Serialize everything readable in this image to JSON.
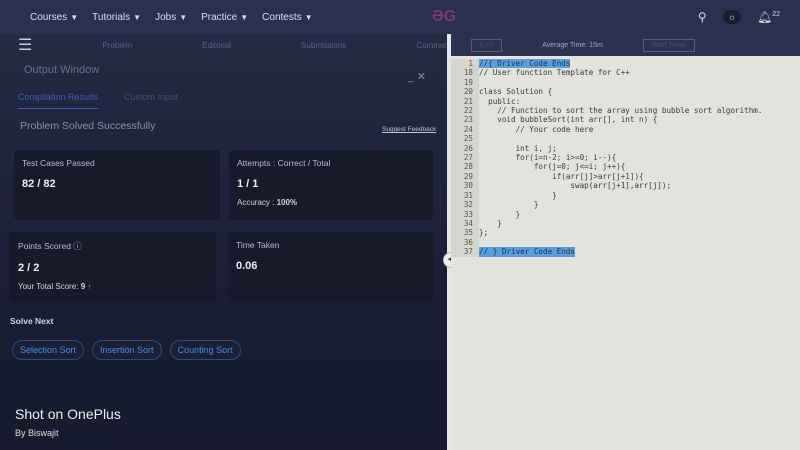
{
  "nav": {
    "items": [
      "Courses",
      "Tutorials",
      "Jobs",
      "Practice",
      "Contests"
    ],
    "notif_count": "22"
  },
  "subnav": {
    "tabs": [
      "Problem",
      "Editorial",
      "Submissions",
      "Comments"
    ],
    "avg_time": "Average Time: 15m",
    "start_timer": "Start Timer"
  },
  "output": {
    "title": "Output Window",
    "tabs": [
      "Compilation Results",
      "Custom Input"
    ],
    "status": "Problem Solved Successfully",
    "feedback": "Suggest Feedback"
  },
  "cards": {
    "tests_label": "Test Cases Passed",
    "tests_value": "82 / 82",
    "attempts_label": "Attempts : Correct / Total",
    "attempts_value": "1 / 1",
    "accuracy_label": "Accuracy :",
    "accuracy_value": "100%",
    "points_label": "Points Scored",
    "points_value": "2 / 2",
    "total_label": "Your Total Score:",
    "total_value": "9",
    "time_label": "Time Taken",
    "time_value": "0.06"
  },
  "solve_next": {
    "label": "Solve Next",
    "items": [
      "Selection Sort",
      "Insertion Sort",
      "Counting Sort"
    ]
  },
  "watermark": {
    "line1": "Shot on OnePlus",
    "line2": "By Biswajit"
  },
  "code": [
    {
      "n": "1",
      "t": "//{ Driver Code Ends",
      "hl": true
    },
    {
      "n": "18",
      "t": "// User function Template for C++"
    },
    {
      "n": "19",
      "t": ""
    },
    {
      "n": "20",
      "t": "class Solution {"
    },
    {
      "n": "21",
      "t": "  public:"
    },
    {
      "n": "22",
      "t": "    // Function to sort the array using bubble sort algorithm."
    },
    {
      "n": "23",
      "t": "    void bubbleSort(int arr[], int n) {"
    },
    {
      "n": "24",
      "t": "        // Your code here"
    },
    {
      "n": "25",
      "t": ""
    },
    {
      "n": "26",
      "t": "        int i, j;"
    },
    {
      "n": "27",
      "t": "        for(i=n-2; i>=0; i--){"
    },
    {
      "n": "28",
      "t": "            for(j=0; j<=i; j++){"
    },
    {
      "n": "29",
      "t": "                if(arr[j]>arr[j+1]){"
    },
    {
      "n": "30",
      "t": "                    swap(arr[j+1],arr[j]);"
    },
    {
      "n": "31",
      "t": "                }"
    },
    {
      "n": "32",
      "t": "            }"
    },
    {
      "n": "33",
      "t": "        }"
    },
    {
      "n": "34",
      "t": "    }"
    },
    {
      "n": "35",
      "t": "};"
    },
    {
      "n": "36",
      "t": ""
    },
    {
      "n": "37",
      "t": "// } Driver Code Ends",
      "hl": true
    }
  ]
}
